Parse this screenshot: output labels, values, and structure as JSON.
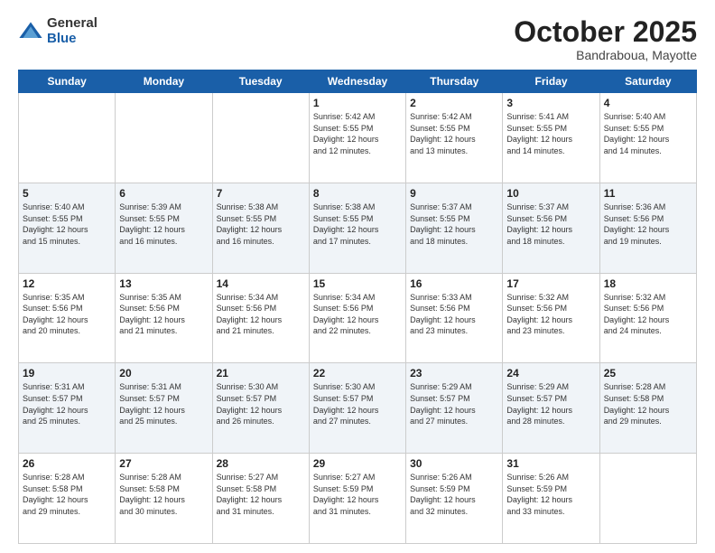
{
  "logo": {
    "general": "General",
    "blue": "Blue"
  },
  "header": {
    "month": "October 2025",
    "location": "Bandraboua, Mayotte"
  },
  "weekdays": [
    "Sunday",
    "Monday",
    "Tuesday",
    "Wednesday",
    "Thursday",
    "Friday",
    "Saturday"
  ],
  "weeks": [
    [
      {
        "day": "",
        "info": ""
      },
      {
        "day": "",
        "info": ""
      },
      {
        "day": "",
        "info": ""
      },
      {
        "day": "1",
        "info": "Sunrise: 5:42 AM\nSunset: 5:55 PM\nDaylight: 12 hours\nand 12 minutes."
      },
      {
        "day": "2",
        "info": "Sunrise: 5:42 AM\nSunset: 5:55 PM\nDaylight: 12 hours\nand 13 minutes."
      },
      {
        "day": "3",
        "info": "Sunrise: 5:41 AM\nSunset: 5:55 PM\nDaylight: 12 hours\nand 14 minutes."
      },
      {
        "day": "4",
        "info": "Sunrise: 5:40 AM\nSunset: 5:55 PM\nDaylight: 12 hours\nand 14 minutes."
      }
    ],
    [
      {
        "day": "5",
        "info": "Sunrise: 5:40 AM\nSunset: 5:55 PM\nDaylight: 12 hours\nand 15 minutes."
      },
      {
        "day": "6",
        "info": "Sunrise: 5:39 AM\nSunset: 5:55 PM\nDaylight: 12 hours\nand 16 minutes."
      },
      {
        "day": "7",
        "info": "Sunrise: 5:38 AM\nSunset: 5:55 PM\nDaylight: 12 hours\nand 16 minutes."
      },
      {
        "day": "8",
        "info": "Sunrise: 5:38 AM\nSunset: 5:55 PM\nDaylight: 12 hours\nand 17 minutes."
      },
      {
        "day": "9",
        "info": "Sunrise: 5:37 AM\nSunset: 5:55 PM\nDaylight: 12 hours\nand 18 minutes."
      },
      {
        "day": "10",
        "info": "Sunrise: 5:37 AM\nSunset: 5:56 PM\nDaylight: 12 hours\nand 18 minutes."
      },
      {
        "day": "11",
        "info": "Sunrise: 5:36 AM\nSunset: 5:56 PM\nDaylight: 12 hours\nand 19 minutes."
      }
    ],
    [
      {
        "day": "12",
        "info": "Sunrise: 5:35 AM\nSunset: 5:56 PM\nDaylight: 12 hours\nand 20 minutes."
      },
      {
        "day": "13",
        "info": "Sunrise: 5:35 AM\nSunset: 5:56 PM\nDaylight: 12 hours\nand 21 minutes."
      },
      {
        "day": "14",
        "info": "Sunrise: 5:34 AM\nSunset: 5:56 PM\nDaylight: 12 hours\nand 21 minutes."
      },
      {
        "day": "15",
        "info": "Sunrise: 5:34 AM\nSunset: 5:56 PM\nDaylight: 12 hours\nand 22 minutes."
      },
      {
        "day": "16",
        "info": "Sunrise: 5:33 AM\nSunset: 5:56 PM\nDaylight: 12 hours\nand 23 minutes."
      },
      {
        "day": "17",
        "info": "Sunrise: 5:32 AM\nSunset: 5:56 PM\nDaylight: 12 hours\nand 23 minutes."
      },
      {
        "day": "18",
        "info": "Sunrise: 5:32 AM\nSunset: 5:56 PM\nDaylight: 12 hours\nand 24 minutes."
      }
    ],
    [
      {
        "day": "19",
        "info": "Sunrise: 5:31 AM\nSunset: 5:57 PM\nDaylight: 12 hours\nand 25 minutes."
      },
      {
        "day": "20",
        "info": "Sunrise: 5:31 AM\nSunset: 5:57 PM\nDaylight: 12 hours\nand 25 minutes."
      },
      {
        "day": "21",
        "info": "Sunrise: 5:30 AM\nSunset: 5:57 PM\nDaylight: 12 hours\nand 26 minutes."
      },
      {
        "day": "22",
        "info": "Sunrise: 5:30 AM\nSunset: 5:57 PM\nDaylight: 12 hours\nand 27 minutes."
      },
      {
        "day": "23",
        "info": "Sunrise: 5:29 AM\nSunset: 5:57 PM\nDaylight: 12 hours\nand 27 minutes."
      },
      {
        "day": "24",
        "info": "Sunrise: 5:29 AM\nSunset: 5:57 PM\nDaylight: 12 hours\nand 28 minutes."
      },
      {
        "day": "25",
        "info": "Sunrise: 5:28 AM\nSunset: 5:58 PM\nDaylight: 12 hours\nand 29 minutes."
      }
    ],
    [
      {
        "day": "26",
        "info": "Sunrise: 5:28 AM\nSunset: 5:58 PM\nDaylight: 12 hours\nand 29 minutes."
      },
      {
        "day": "27",
        "info": "Sunrise: 5:28 AM\nSunset: 5:58 PM\nDaylight: 12 hours\nand 30 minutes."
      },
      {
        "day": "28",
        "info": "Sunrise: 5:27 AM\nSunset: 5:58 PM\nDaylight: 12 hours\nand 31 minutes."
      },
      {
        "day": "29",
        "info": "Sunrise: 5:27 AM\nSunset: 5:59 PM\nDaylight: 12 hours\nand 31 minutes."
      },
      {
        "day": "30",
        "info": "Sunrise: 5:26 AM\nSunset: 5:59 PM\nDaylight: 12 hours\nand 32 minutes."
      },
      {
        "day": "31",
        "info": "Sunrise: 5:26 AM\nSunset: 5:59 PM\nDaylight: 12 hours\nand 33 minutes."
      },
      {
        "day": "",
        "info": ""
      }
    ]
  ]
}
